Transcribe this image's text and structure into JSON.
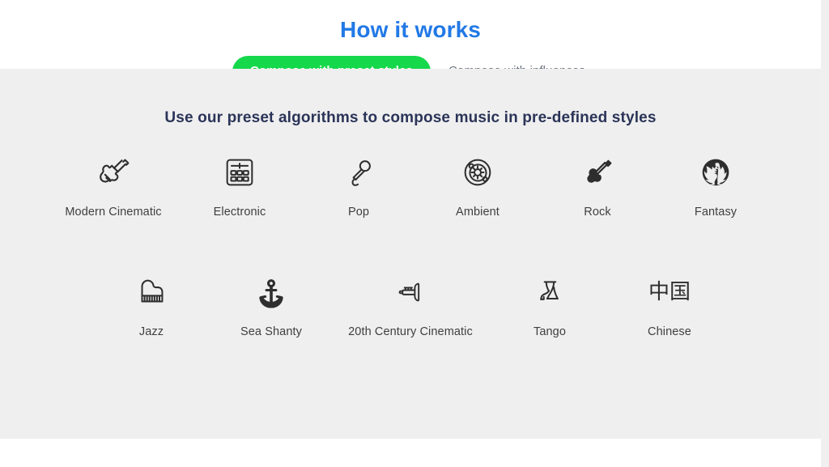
{
  "header": {
    "title": "How it works",
    "title_color": "#2279e6",
    "tabs": [
      {
        "label": "Compose with preset styles",
        "active": true,
        "name": "tab-compose-preset-styles"
      },
      {
        "label": "Compose with influences",
        "active": false,
        "name": "tab-compose-influences"
      }
    ],
    "active_tab_color": "#16d84b",
    "inactive_tab_color": "#6d7480"
  },
  "main": {
    "subtitle": "Use our preset algorithms to compose music in pre-defined styles",
    "subtitle_color": "#2b3458",
    "background_color": "#efefef",
    "rows": [
      {
        "items": [
          {
            "label": "Modern Cinematic",
            "icon": "violin-icon"
          },
          {
            "label": "Electronic",
            "icon": "drum-machine-icon"
          },
          {
            "label": "Pop",
            "icon": "microphone-icon"
          },
          {
            "label": "Ambient",
            "icon": "atom-icon"
          },
          {
            "label": "Rock",
            "icon": "electric-guitar-icon"
          },
          {
            "label": "Fantasy",
            "icon": "dragon-icon"
          }
        ]
      },
      {
        "items": [
          {
            "label": "Jazz",
            "icon": "grand-piano-icon"
          },
          {
            "label": "Sea Shanty",
            "icon": "anchor-icon"
          },
          {
            "label": "20th Century Cinematic",
            "icon": "trumpet-icon"
          },
          {
            "label": "Tango",
            "icon": "tango-dancers-icon"
          },
          {
            "label": "Chinese",
            "icon": "chinese-characters-icon",
            "glyph": "中国"
          }
        ]
      }
    ]
  }
}
